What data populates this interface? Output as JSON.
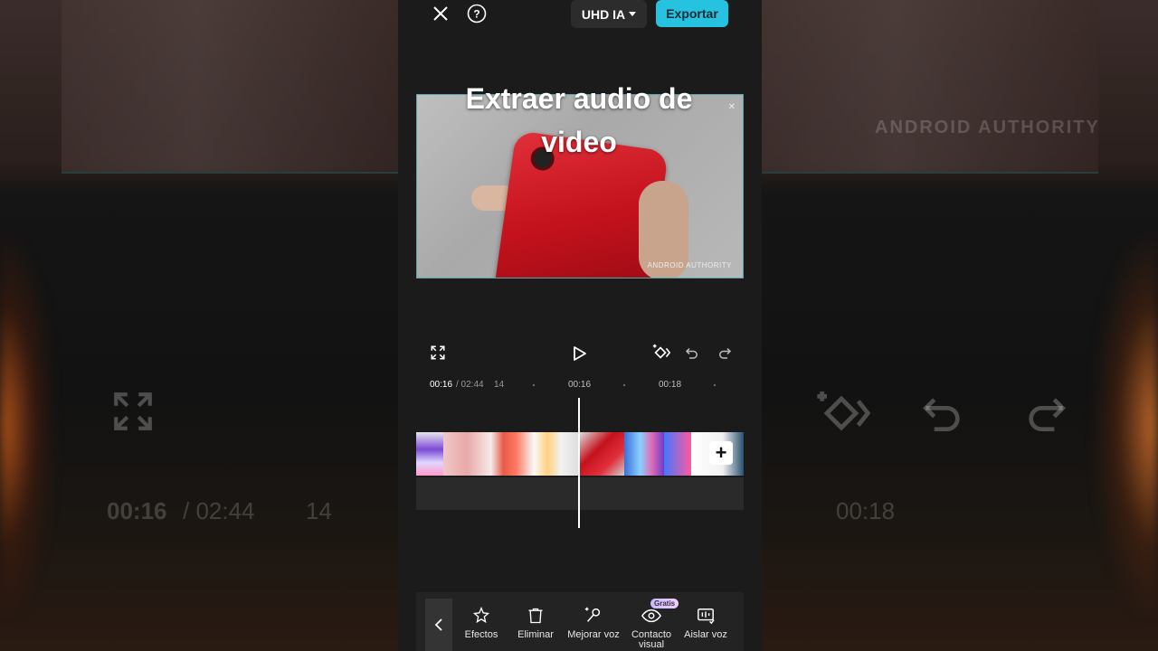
{
  "topbar": {
    "close_label": "close",
    "quality_label": "UHD IA",
    "export_label": "Exportar"
  },
  "overlay": {
    "title_line1": "Extraer audio de",
    "title_line2": "video"
  },
  "preview": {
    "watermark": "ANDROID AUTHORITY"
  },
  "timeline": {
    "current_time": "00:16",
    "total_time": "/ 02:44",
    "tick_a": "14",
    "tick_b": "00:16",
    "tick_c": "00:18"
  },
  "toolbar": {
    "items": [
      {
        "label": "Efectos",
        "icon": "effects-icon"
      },
      {
        "label": "Eliminar",
        "icon": "trash-icon"
      },
      {
        "label": "Mejorar voz",
        "icon": "enhance-voice-icon"
      },
      {
        "label": "Contacto\nvisual",
        "icon": "eye-contact-icon"
      },
      {
        "label": "Aislar voz",
        "icon": "isolate-voice-icon"
      }
    ],
    "badge": "Gratis"
  },
  "background": {
    "time_current": "00:16",
    "time_total": "/ 02:44",
    "tick": "14",
    "time_next": "00:18"
  },
  "colors": {
    "accent": "#25c3e0",
    "panel": "#1b1b1b"
  }
}
